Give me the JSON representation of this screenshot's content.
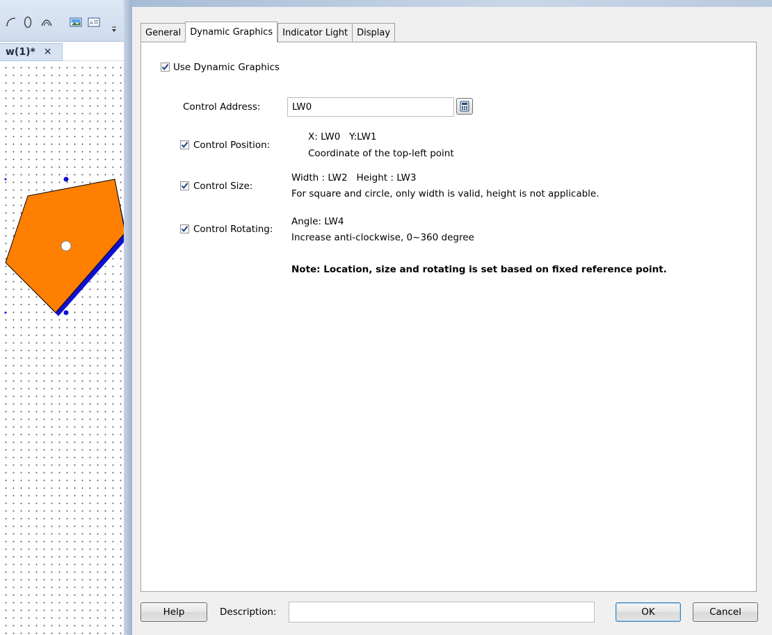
{
  "editor": {
    "doc_tab_label": "w(1)*",
    "doc_tab_close": "✕",
    "shape_fill_color": "#FF7F00",
    "shape_edge_color": "#1010D0"
  },
  "dialog": {
    "tabs": [
      {
        "label": "General",
        "active": false
      },
      {
        "label": "Dynamic Graphics",
        "active": true
      },
      {
        "label": "Indicator Light",
        "active": false
      },
      {
        "label": "Display",
        "active": false
      }
    ],
    "use_dynamic_graphics": {
      "label": "Use Dynamic Graphics",
      "checked": true
    },
    "control_address": {
      "label": "Control Address:",
      "value": "LW0"
    },
    "control_position": {
      "label": "Control Position:",
      "checked": true,
      "line1": "X: LW0   Y:LW1",
      "line2": "Coordinate of the top-left point"
    },
    "control_size": {
      "label": "Control Size:",
      "checked": true,
      "line1": "Width : LW2   Height : LW3",
      "line2": "For square and circle, only width is valid, height is not applicable."
    },
    "control_rotating": {
      "label": "Control Rotating:",
      "checked": true,
      "line1": "Angle: LW4",
      "line2": "Increase anti-clockwise, 0~360 degree"
    },
    "note": "Note: Location, size and rotating is set based on fixed reference point.",
    "footer": {
      "help_label": "Help",
      "description_label": "Description:",
      "description_value": "",
      "ok_label": "OK",
      "cancel_label": "Cancel"
    }
  }
}
